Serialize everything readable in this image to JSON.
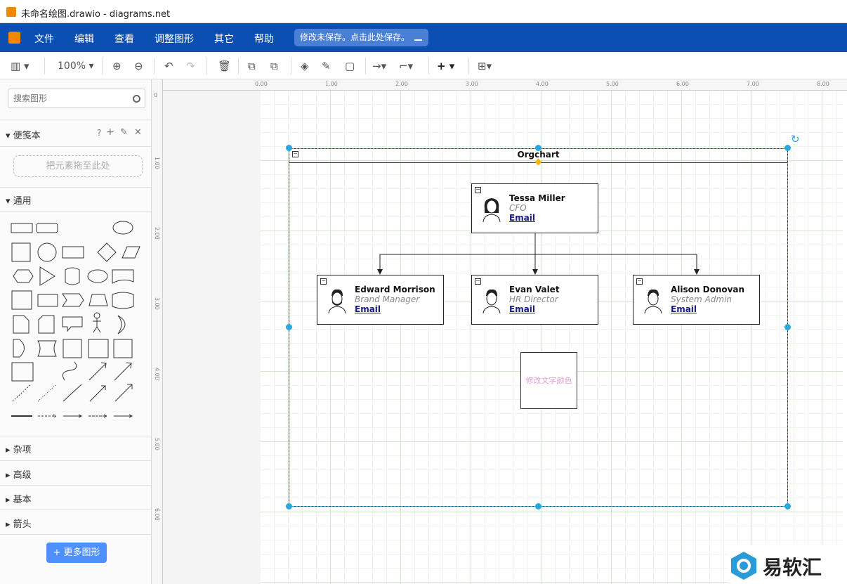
{
  "window": {
    "title": "未命名绘图.drawio - diagrams.net"
  },
  "menu": {
    "items": [
      "文件",
      "编辑",
      "查看",
      "调整图形",
      "其它",
      "帮助"
    ],
    "save_notice": "修改未保存。点击此处保存。"
  },
  "toolbar": {
    "zoom": "100%"
  },
  "sidebar": {
    "search_placeholder": "搜索图形",
    "scratchpad": {
      "title": "便笺本",
      "help": "?",
      "drop_hint": "把元素拖至此处"
    },
    "general": {
      "title": "通用"
    },
    "sections": [
      "杂项",
      "高级",
      "基本",
      "箭头"
    ],
    "more_shapes": "更多图形"
  },
  "ruler": {
    "top_ticks": [
      "0.00",
      "1.00",
      "2.00",
      "3.00",
      "4.00",
      "5.00",
      "6.00",
      "7.00",
      "8.00"
    ],
    "left_ticks": [
      "0",
      "1.00",
      "2.00",
      "3.00",
      "4.00",
      "5.00",
      "6.00"
    ]
  },
  "diagram": {
    "container_title": "Orgchart",
    "cfo": {
      "name": "Tessa Miller",
      "role": "CFO",
      "email": "Email"
    },
    "reports": [
      {
        "name": "Edward Morrison",
        "role": "Brand Manager",
        "email": "Email"
      },
      {
        "name": "Evan Valet",
        "role": "HR Director",
        "email": "Email"
      },
      {
        "name": "Alison Donovan",
        "role": "System Admin",
        "email": "Email"
      }
    ],
    "text_box": "修改文字颜色"
  },
  "watermark": {
    "text": "易软汇"
  },
  "colors": {
    "menubar": "#0b4fb3",
    "selection": "#29a8e0",
    "accent": "#4d90fe",
    "text_box": "#e0a0d0"
  }
}
